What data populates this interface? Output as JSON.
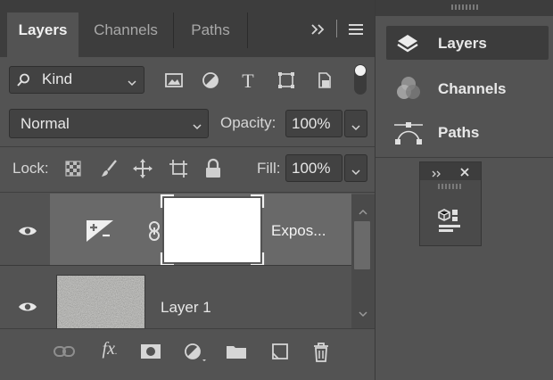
{
  "tabs": [
    {
      "label": "Layers",
      "active": true
    },
    {
      "label": "Channels",
      "active": false
    },
    {
      "label": "Paths",
      "active": false
    }
  ],
  "filter": {
    "kind_label": "Kind",
    "icons": [
      "image-filter-icon",
      "adjustment-filter-icon",
      "type-filter-icon",
      "shape-filter-icon",
      "smart-object-filter-icon"
    ]
  },
  "blend": {
    "mode": "Normal",
    "opacity_label": "Opacity:",
    "opacity_value": "100%"
  },
  "lock": {
    "label": "Lock:",
    "fill_label": "Fill:",
    "fill_value": "100%"
  },
  "layers": [
    {
      "name": "Expos...",
      "type": "adjustment",
      "selected": true,
      "visible": true
    },
    {
      "name": "Layer 1",
      "type": "pixel",
      "selected": false,
      "visible": true
    }
  ],
  "dock": {
    "items": [
      {
        "label": "Layers",
        "active": true
      },
      {
        "label": "Channels",
        "active": false
      },
      {
        "label": "Paths",
        "active": false
      }
    ]
  },
  "colors": {
    "panel_bg": "#535353",
    "tab_bar_bg": "#3d3d3d",
    "selected_row": "#696969",
    "field_bg": "#424242"
  }
}
